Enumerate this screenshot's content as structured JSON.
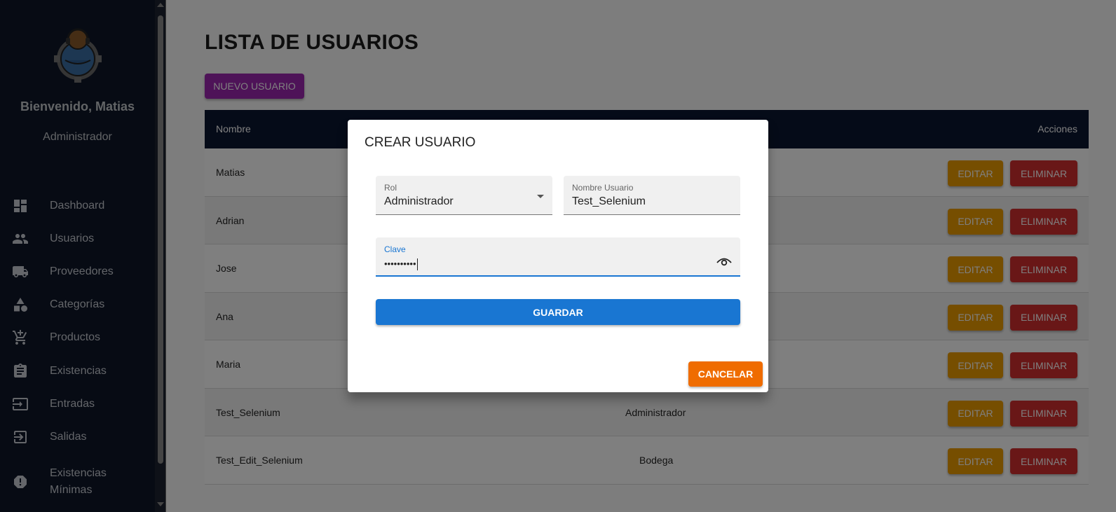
{
  "sidebar": {
    "welcome": "Bienvenido, Matias",
    "role": "Administrador",
    "items": [
      {
        "label": "Dashboard",
        "icon": "dashboard-icon"
      },
      {
        "label": "Usuarios",
        "icon": "people-icon"
      },
      {
        "label": "Proveedores",
        "icon": "truck-icon"
      },
      {
        "label": "Categorías",
        "icon": "category-icon"
      },
      {
        "label": "Productos",
        "icon": "cart-icon"
      },
      {
        "label": "Existencias",
        "icon": "clipboard-icon"
      },
      {
        "label": "Entradas",
        "icon": "input-icon"
      },
      {
        "label": "Salidas",
        "icon": "logout-icon"
      },
      {
        "label": "Existencias Mínimas",
        "icon": "alert-icon"
      }
    ]
  },
  "main": {
    "title": "LISTA DE USUARIOS",
    "new_button": "NUEVO USUARIO",
    "table": {
      "headers": {
        "name": "Nombre",
        "actions": "Acciones"
      },
      "edit_label": "EDITAR",
      "delete_label": "ELIMINAR",
      "rows": [
        {
          "name": "Matias",
          "role": ""
        },
        {
          "name": "Adrian",
          "role": ""
        },
        {
          "name": "Jose",
          "role": ""
        },
        {
          "name": "Ana",
          "role": ""
        },
        {
          "name": "Maria",
          "role": ""
        },
        {
          "name": "Test_Selenium",
          "role": "Administrador"
        },
        {
          "name": "Test_Edit_Selenium",
          "role": "Bodega"
        }
      ]
    }
  },
  "dialog": {
    "title": "CREAR USUARIO",
    "rol": {
      "label": "Rol",
      "value": "Administrador"
    },
    "username": {
      "label": "Nombre Usuario",
      "value": "Test_Selenium"
    },
    "password": {
      "label": "Clave",
      "value": "••••••••••"
    },
    "save_label": "GUARDAR",
    "cancel_label": "CANCELAR"
  },
  "colors": {
    "sidebar_bg": "#0f1729",
    "primary": "#1976d2",
    "purple": "#9c27b0",
    "edit": "#ed9c00",
    "delete": "#d32f2f",
    "cancel": "#ef6c00",
    "table_header": "#0b1630"
  }
}
